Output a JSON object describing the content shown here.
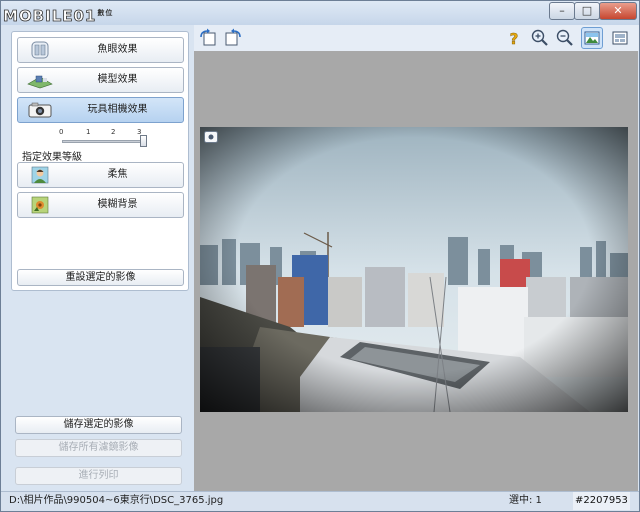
{
  "window": {
    "logo_text": "MOBILE01",
    "logo_sup": "數位",
    "min_glyph": "–",
    "max_glyph": "□",
    "close_glyph": "✕"
  },
  "effects": {
    "items": [
      {
        "label": "魚眼效果",
        "icon": "fisheye-icon",
        "selected": false
      },
      {
        "label": "模型效果",
        "icon": "miniature-model-icon",
        "selected": false
      },
      {
        "label": "玩具相機效果",
        "icon": "toy-camera-icon",
        "selected": true
      },
      {
        "label": "柔焦",
        "icon": "soft-focus-portrait-icon",
        "selected": false
      },
      {
        "label": "模糊背景",
        "icon": "blur-background-icon",
        "selected": false
      }
    ],
    "slider": {
      "ticks": [
        "0",
        "1",
        "2",
        "3"
      ],
      "value": 3
    },
    "level_label": "指定效果等級",
    "reset_label": "重設選定的影像"
  },
  "actions": {
    "save_selected": "儲存選定的影像",
    "save_all": "儲存所有濾鏡影像",
    "print": "進行列印"
  },
  "toolbar": {
    "items": [
      "rotate-left-icon",
      "rotate-right-icon",
      "help-icon",
      "zoom-in-icon",
      "zoom-out-icon",
      "single-image-view-icon",
      "filmstrip-view-icon"
    ],
    "active": "single-image-view-icon"
  },
  "status": {
    "path": "D:\\相片作品\\990504~6東京行\\DSC_3765.jpg",
    "selected": "選中: 1",
    "watermark": "#2207953"
  },
  "colors": {
    "accent": "#7da2ce",
    "window_bg": "#d9e4f1",
    "viewer_bg": "#a8a8a8"
  }
}
